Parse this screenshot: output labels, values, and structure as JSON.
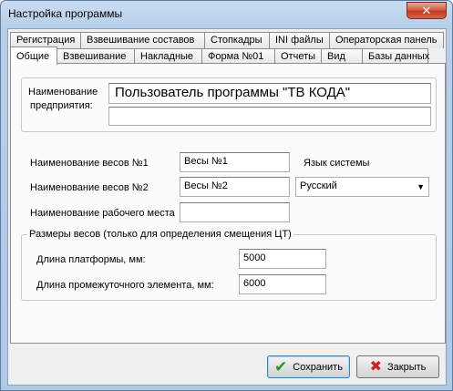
{
  "window": {
    "title": "Настройка программы",
    "close_label": "✕"
  },
  "tabs_row1": [
    "Регистрация",
    "Взвешивание составов",
    "Стопкадры",
    "INI файлы",
    "Операторская панель"
  ],
  "tabs_row2": [
    "Общие",
    "Взвешивание",
    "Накладные",
    "Форма №01",
    "Отчеты",
    "Вид",
    "Базы данных"
  ],
  "general": {
    "enterprise_label_line1": "Наименование",
    "enterprise_label_line2": "предприятия:",
    "enterprise_name": "Пользователь программы \"ТВ КОДА\"",
    "enterprise_name2": "",
    "scale1_label": "Наименование весов №1",
    "scale1_value": "Весы №1",
    "scale2_label": "Наименование весов №2",
    "scale2_value": "Весы №2",
    "workplace_label": "Наименование рабочего места",
    "workplace_value": "",
    "language_label": "Язык системы",
    "language_value": "Русский",
    "sizes_group_title": "Размеры весов (только для определения смещения ЦТ)",
    "platform_label": "Длина платформы, мм:",
    "platform_value": "5000",
    "intermediate_label": "Длина промежуточного элемента, мм:",
    "intermediate_value": "6000"
  },
  "buttons": {
    "save": "Сохранить",
    "close": "Закрыть"
  }
}
